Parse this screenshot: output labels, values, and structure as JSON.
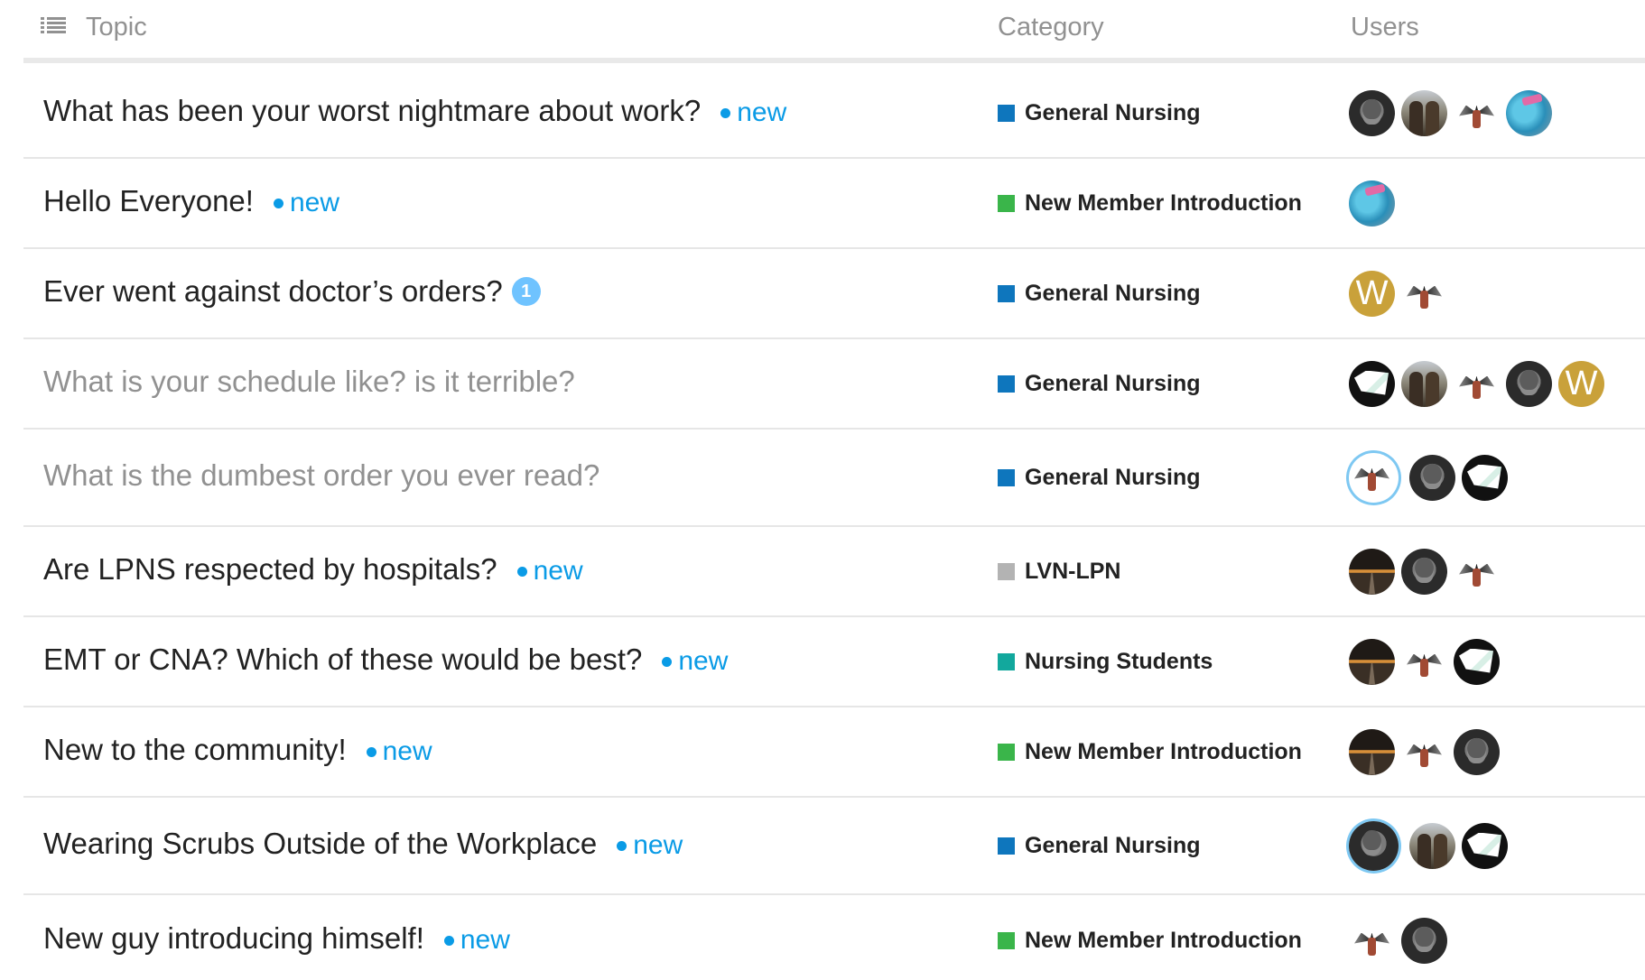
{
  "header": {
    "topic_label": "Topic",
    "category_label": "Category",
    "users_label": "Users",
    "list_icon": "list-icon"
  },
  "colors": {
    "new_badge": "#0a9be6",
    "count_badge": "#6fc3ff",
    "category_general": "#0e76bd",
    "category_new_member": "#3ab54a",
    "category_lvn": "#b3b3b3",
    "category_students": "#12a89d"
  },
  "topics": [
    {
      "title": "What has been your worst nightmare about work?",
      "visited": false,
      "new_label": "new",
      "category": "General Nursing",
      "category_color": "#0e76bd",
      "users": [
        "gorilla-avatar",
        "duo-avatar",
        "wings-avatar",
        "blue-avatar"
      ]
    },
    {
      "title": "Hello Everyone!",
      "visited": false,
      "new_label": "new",
      "category": "New Member Introduction",
      "category_color": "#3ab54a",
      "users": [
        "blue-avatar"
      ]
    },
    {
      "title": "Ever went against doctor’s orders?",
      "visited": false,
      "unread_count": "1",
      "category": "General Nursing",
      "category_color": "#0e76bd",
      "users": [
        "letter-w-avatar",
        "wings-avatar"
      ],
      "letter": "W"
    },
    {
      "title": "What is your schedule like? is it terrible?",
      "visited": true,
      "category": "General Nursing",
      "category_color": "#0e76bd",
      "users": [
        "map-avatar",
        "duo-avatar",
        "wings-avatar",
        "gorilla-avatar",
        "letter-w-avatar"
      ],
      "letter": "W"
    },
    {
      "title": "What is the dumbest order you ever read?",
      "visited": true,
      "category": "General Nursing",
      "category_color": "#0e76bd",
      "users": [
        "wings-avatar",
        "gorilla-avatar",
        "map-avatar"
      ]
    },
    {
      "title": "Are LPNS respected by hospitals?",
      "visited": false,
      "new_label": "new",
      "category": "LVN-LPN",
      "category_color": "#b3b3b3",
      "users": [
        "road-avatar",
        "gorilla-avatar",
        "wings-avatar"
      ]
    },
    {
      "title": "EMT or CNA? Which of these would be best?",
      "visited": false,
      "new_label": "new",
      "category": "Nursing Students",
      "category_color": "#12a89d",
      "users": [
        "road-avatar",
        "wings-avatar",
        "map-avatar"
      ]
    },
    {
      "title": "New to the community!",
      "visited": false,
      "new_label": "new",
      "category": "New Member Introduction",
      "category_color": "#3ab54a",
      "users": [
        "road-avatar",
        "wings-avatar",
        "gorilla-avatar"
      ]
    },
    {
      "title": "Wearing Scrubs Outside of the Workplace",
      "visited": false,
      "new_label": "new",
      "category": "General Nursing",
      "category_color": "#0e76bd",
      "users": [
        "gorilla-avatar",
        "duo-avatar",
        "map-avatar"
      ]
    },
    {
      "title": "New guy introducing himself!",
      "visited": false,
      "new_label": "new",
      "category": "New Member Introduction",
      "category_color": "#3ab54a",
      "users": [
        "wings-avatar",
        "gorilla-avatar"
      ]
    }
  ]
}
